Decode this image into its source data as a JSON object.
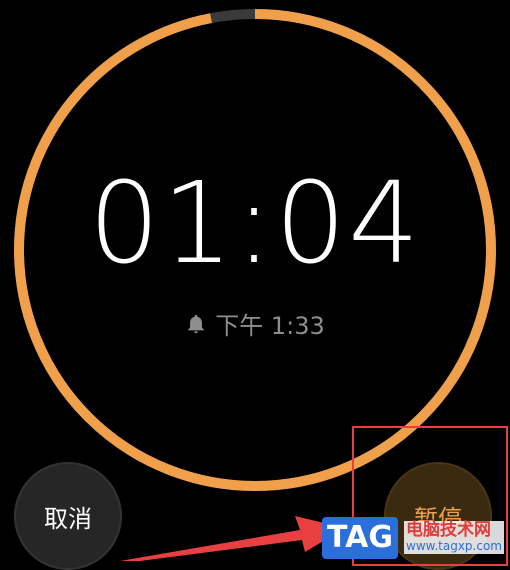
{
  "timer": {
    "remaining": "01:04",
    "progress_fraction": 0.97,
    "ring_color": "#f0a04b",
    "track_color": "#3a3a3a"
  },
  "alarm": {
    "icon": "bell-icon",
    "label": "下午 1:33"
  },
  "buttons": {
    "cancel_label": "取消",
    "pause_label": "暂停"
  },
  "watermark": {
    "badge": "TAG",
    "title": "电脑技术网",
    "url": "www.tagxp.com"
  },
  "colors": {
    "background": "#000000",
    "accent": "#f0a04b",
    "annotation": "#e84040"
  }
}
